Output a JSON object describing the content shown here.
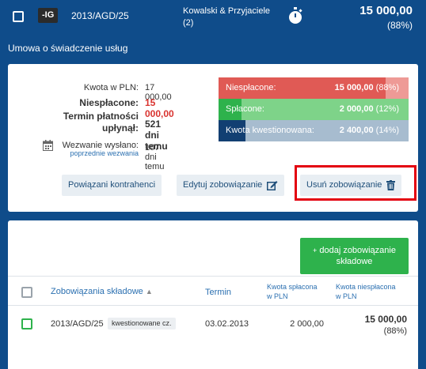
{
  "header": {
    "tag": "-IG",
    "doc_number": "2013/AGD/25",
    "company": "Kowalski & Przyjaciele (2)",
    "amount": "15 000,00",
    "percent": "(88%)"
  },
  "subtitle": "Umowa o świadczenie usług",
  "summary": {
    "amount_label": "Kwota w PLN:",
    "amount_value": "17 000,00",
    "unpaid_label": "Niespłacone:",
    "unpaid_value": "15 000,00",
    "deadline_label_1": "Termin płatności",
    "deadline_label_2": "upłynął:",
    "deadline_value": "521 dni temu",
    "reminder_label": "Wezwanie wysłano:",
    "reminder_link": "poprzednie wezwania",
    "reminder_value": "107 dni temu"
  },
  "bars": [
    {
      "label": "Niespłacone:",
      "value": "15 000,00",
      "pct": "(88%)",
      "fraction": 0.88,
      "color": "#e05a55",
      "rest": "#ee9a96"
    },
    {
      "label": "Spłacone:",
      "value": "2 000,00",
      "pct": "(12%)",
      "fraction": 0.12,
      "color": "#2eb24c",
      "rest": "#7ed389"
    },
    {
      "label": "Kwota kwestionowana:",
      "value": "2 400,00",
      "pct": "(14%)",
      "fraction": 0.14,
      "color": "#123f72",
      "rest": "#a7bccf"
    }
  ],
  "actions": {
    "related": "Powiązani kontrahenci",
    "edit": "Edytuj zobowiązanie",
    "delete": "Usuń zobowiązanie"
  },
  "sub": {
    "add_button": "dodaj zobowiązanie składowe",
    "col_name": "Zobowiązania składowe",
    "col_date": "Termin",
    "col_paid_1": "Kwota spłacona",
    "col_paid_2": "w PLN",
    "col_unpaid_1": "Kwota niespłacona",
    "col_unpaid_2": "w PLN",
    "rows": [
      {
        "doc": "2013/AGD/25",
        "badge": "kwestionowane cz.",
        "date": "03.02.2013",
        "paid": "2 000,00",
        "unpaid": "15 000,00",
        "unpaid_pct": "(88%)"
      }
    ]
  },
  "colors": {
    "brand": "#0f4c8a",
    "accent": "#2eb24c",
    "alert": "#d9332f",
    "highlight": "#e3000f"
  }
}
